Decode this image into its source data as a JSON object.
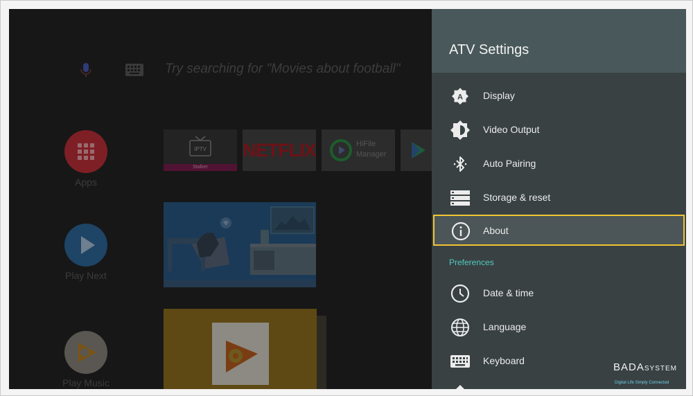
{
  "launcher": {
    "search_hint": "Try searching for \"Movies about football\"",
    "nav": [
      {
        "label": "Apps",
        "icon": "apps-grid-icon",
        "color": "#7e1f25"
      },
      {
        "label": "Play Next",
        "icon": "play-icon",
        "color": "#1e4466"
      },
      {
        "label": "Play Music",
        "icon": "play-music-icon",
        "color": "#5a5753"
      }
    ],
    "tiles": {
      "iptv_text": "IPTV",
      "iptv_caption": "Stalker",
      "netflix": "NETFLIX",
      "hifile_line1": "HiFile",
      "hifile_line2": "Manager"
    }
  },
  "settings": {
    "title": "ATV Settings",
    "items": [
      {
        "label": "Display",
        "icon": "display-icon"
      },
      {
        "label": "Video Output",
        "icon": "brightness-icon"
      },
      {
        "label": "Auto Pairing",
        "icon": "bluetooth-icon"
      },
      {
        "label": "Storage & reset",
        "icon": "storage-icon"
      },
      {
        "label": "About",
        "icon": "info-icon",
        "focused": true
      }
    ],
    "preferences_header": "Preferences",
    "preferences": [
      {
        "label": "Date & time",
        "icon": "clock-icon"
      },
      {
        "label": "Language",
        "icon": "globe-icon"
      },
      {
        "label": "Keyboard",
        "icon": "keyboard-icon"
      }
    ]
  },
  "watermark": {
    "brand": "BADA",
    "brand_suffix": "SYSTEM",
    "tagline": "Digital Life Simply Connected"
  },
  "colors": {
    "panel_bg": "#394143",
    "panel_header": "#49585a",
    "focus_border": "#f2c533",
    "section_header": "#53cbc0"
  }
}
